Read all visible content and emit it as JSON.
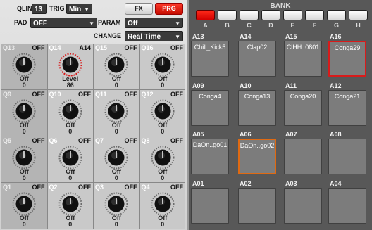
{
  "header": {
    "qlink_label": "QLINK",
    "qlink_value": "13",
    "trig_label": "TRIG",
    "trig_value": "Min",
    "fx_button": "FX",
    "prg_button": "PRG",
    "pad_label": "PAD",
    "pad_value": "OFF",
    "param_label": "PARAM",
    "param_value": "Off",
    "change_label": "CHANGE",
    "change_value": "Real Time",
    "dropdown_arrow": "▼"
  },
  "knobs": [
    {
      "q": "Q13",
      "state": "OFF",
      "name": "Off",
      "value": "0",
      "active": false
    },
    {
      "q": "Q14",
      "state": "A14",
      "name": "Level",
      "value": "86",
      "active": true
    },
    {
      "q": "Q15",
      "state": "OFF",
      "name": "Off",
      "value": "0",
      "active": false
    },
    {
      "q": "Q16",
      "state": "OFF",
      "name": "Off",
      "value": "0",
      "active": false
    },
    {
      "q": "Q9",
      "state": "OFF",
      "name": "Off",
      "value": "0",
      "active": false
    },
    {
      "q": "Q10",
      "state": "OFF",
      "name": "Off",
      "value": "0",
      "active": false
    },
    {
      "q": "Q11",
      "state": "OFF",
      "name": "Off",
      "value": "0",
      "active": false
    },
    {
      "q": "Q12",
      "state": "OFF",
      "name": "Off",
      "value": "0",
      "active": false
    },
    {
      "q": "Q5",
      "state": "OFF",
      "name": "Off",
      "value": "0",
      "active": false
    },
    {
      "q": "Q6",
      "state": "OFF",
      "name": "Off",
      "value": "0",
      "active": false
    },
    {
      "q": "Q7",
      "state": "OFF",
      "name": "Off",
      "value": "0",
      "active": false
    },
    {
      "q": "Q8",
      "state": "OFF",
      "name": "Off",
      "value": "0",
      "active": false
    },
    {
      "q": "Q1",
      "state": "OFF",
      "name": "Off",
      "value": "0",
      "active": false
    },
    {
      "q": "Q2",
      "state": "OFF",
      "name": "Off",
      "value": "0",
      "active": false
    },
    {
      "q": "Q3",
      "state": "OFF",
      "name": "Off",
      "value": "0",
      "active": false
    },
    {
      "q": "Q4",
      "state": "OFF",
      "name": "Off",
      "value": "0",
      "active": false
    }
  ],
  "bank": {
    "title": "BANK",
    "buttons": [
      "A",
      "B",
      "C",
      "D",
      "E",
      "F",
      "G",
      "H"
    ],
    "selected": "A"
  },
  "pads": [
    {
      "label": "A13",
      "name": "Chill_Kick5",
      "highlight": ""
    },
    {
      "label": "A14",
      "name": "Clap02",
      "highlight": ""
    },
    {
      "label": "A15",
      "name": "ClHH..0801",
      "highlight": ""
    },
    {
      "label": "A16",
      "name": "Conga29",
      "highlight": "red"
    },
    {
      "label": "A09",
      "name": "Conga4",
      "highlight": ""
    },
    {
      "label": "A10",
      "name": "Conga13",
      "highlight": ""
    },
    {
      "label": "A11",
      "name": "Conga20",
      "highlight": ""
    },
    {
      "label": "A12",
      "name": "Conga21",
      "highlight": ""
    },
    {
      "label": "A05",
      "name": "DaOn..go01",
      "highlight": ""
    },
    {
      "label": "A06",
      "name": "DaOn..go02",
      "highlight": "orange"
    },
    {
      "label": "A07",
      "name": "",
      "highlight": ""
    },
    {
      "label": "A08",
      "name": "",
      "highlight": ""
    },
    {
      "label": "A01",
      "name": "",
      "highlight": ""
    },
    {
      "label": "A02",
      "name": "",
      "highlight": ""
    },
    {
      "label": "A03",
      "name": "",
      "highlight": ""
    },
    {
      "label": "A04",
      "name": "",
      "highlight": ""
    }
  ],
  "colors": {
    "accent_red": "#d81b1b",
    "accent_orange": "#e06a12",
    "pad_gray": "#7c7c7c",
    "panel_dark": "#585858"
  }
}
